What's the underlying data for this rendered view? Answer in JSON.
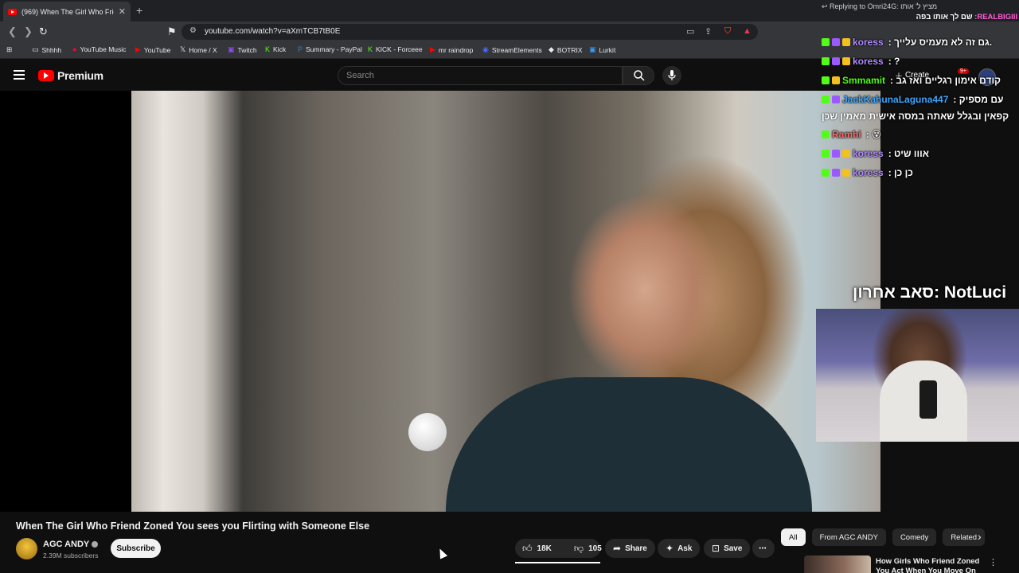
{
  "browser": {
    "tab_title": "(969) When The Girl Who Friend",
    "url": "youtube.com/watch?v=aXmTCB7tB0E",
    "bookmarks": [
      "Shhhh",
      "YouTube Music",
      "YouTube",
      "Home / X",
      "Twitch",
      "Kick",
      "Summary - PayPal",
      "KICK - Forceee",
      "mr raindrop",
      "StreamElements",
      "BOTRIX",
      "Lurkit"
    ]
  },
  "youtube": {
    "logo_text": "Premium",
    "search_placeholder": "Search",
    "create_label": "Create",
    "notif_count": "9+"
  },
  "video": {
    "title": "When The Girl Who Friend Zoned You sees you Flirting with Someone Else",
    "channel_name": "AGC ANDY",
    "subscribers": "2.39M subscribers",
    "subscribe_label": "Subscribe",
    "likes": "18K",
    "dislikes": "105",
    "share_label": "Share",
    "ask_label": "Ask",
    "save_label": "Save"
  },
  "chips": [
    "All",
    "From AGC ANDY",
    "Comedy",
    "Related"
  ],
  "recommended": {
    "title": "How Girls Who Friend Zoned You Act When You Move On"
  },
  "stream_overlay": {
    "reply_line": "Replying to Omri24G: מציץ ל' אותו",
    "pinned": {
      "user": "REALBIGIII:",
      "text": "שם לך אותו בפה"
    },
    "messages": [
      {
        "user": "koress",
        "color": "#b18cff",
        "text": ": גם זה לא מעמיס עלייך."
      },
      {
        "user": "koress",
        "color": "#b18cff",
        "text": ": ?"
      },
      {
        "user": "Smmamit",
        "color": "#53fc18",
        "text": ": קודם אימון רגליים ואז גב"
      },
      {
        "user": "JackKahunaLaguna447",
        "color": "#3ea6ff",
        "text": ": עם מספיק"
      },
      {
        "user": "Ramhi",
        "color": "#ff6b6b",
        "text": ":"
      },
      {
        "user": "koress",
        "color": "#b18cff",
        "text": ": אווו שיט"
      },
      {
        "user": "koress",
        "color": "#b18cff",
        "text": ": כן כן"
      }
    ],
    "wrap_line": "קפאין ובגלל שאתה במסה אישית מאמין שכן",
    "last_sub": "סאב אחרון: NotLuci"
  }
}
